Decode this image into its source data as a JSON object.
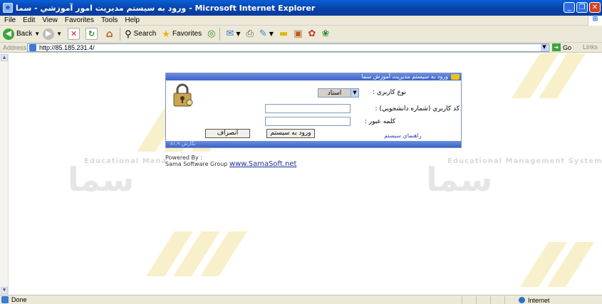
{
  "window": {
    "title": "ورود به سیستم مدیریت امور آموزشي - سما - Microsoft Internet Explorer"
  },
  "menu": {
    "items": [
      "File",
      "Edit",
      "View",
      "Favorites",
      "Tools",
      "Help"
    ]
  },
  "toolbar": {
    "back_label": "Back",
    "search_label": "Search",
    "favorites_label": "Favorites"
  },
  "address": {
    "label": "Address",
    "url": "http://85.185.231.4/",
    "go_label": "Go",
    "links_label": "Links"
  },
  "login": {
    "header_title": "ورود به سيستم مديريت آموزش سما",
    "user_type_label": "نوع کاربري :",
    "user_type_value": "استاد",
    "user_code_label": "کد کاربري (شماره دانشجويي) :",
    "password_label": "كلمه عبور :",
    "login_button": "ورود به سيستم",
    "cancel_button": "انصراف",
    "help_link": "راهنماي سيستم",
    "version": "نگارش ۸۱،۹"
  },
  "watermark": {
    "left_text": "Educational Mana",
    "right_text": "Educational Management System",
    "logo_text": "سما"
  },
  "footer": {
    "powered_by": "Powered By :",
    "company": "Sama Software Group",
    "site_link": "www.SamaSoft.net"
  },
  "status": {
    "text": "Done",
    "zone": "Internet"
  },
  "colors": {
    "titlebar": "#0842a8",
    "chrome": "#ece9d8",
    "panel_header": "#4b6fd0",
    "stripe": "#f4e7a8"
  }
}
